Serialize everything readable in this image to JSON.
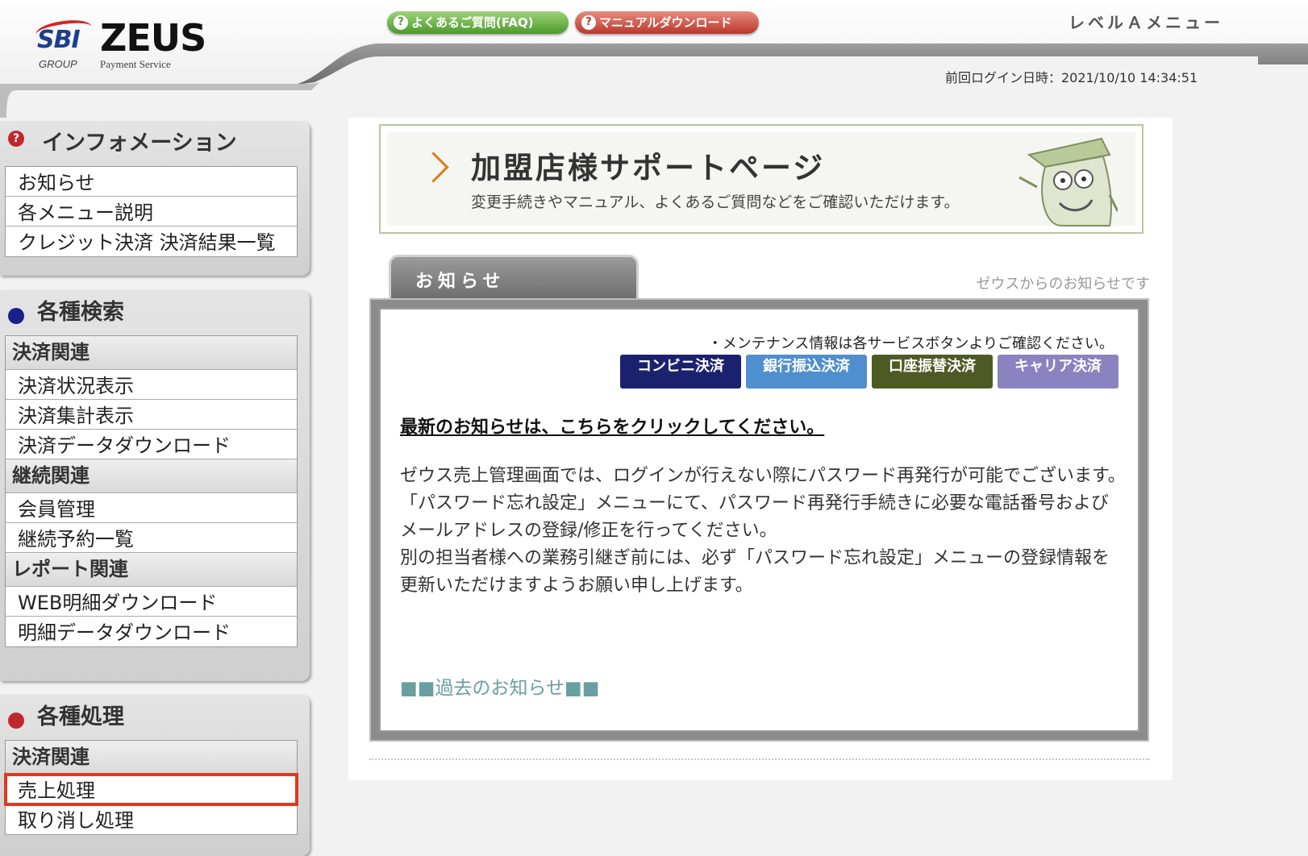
{
  "header": {
    "logo_sbi": "SBI",
    "logo_group": "GROUP",
    "logo_zeus": "ZEUS",
    "logo_payment": "Payment Service",
    "faq_button": "よくあるご質問(FAQ)",
    "manual_button": "マニュアルダウンロード",
    "level_menu": "レベルＡメニュー",
    "last_login": "前回ログイン日時：2021/10/10 14:34:51"
  },
  "sidebar": {
    "info": {
      "title": "インフォメーション",
      "items": [
        "お知らせ",
        "各メニュー説明",
        "クレジット決済 決済結果一覧"
      ]
    },
    "search": {
      "title": "各種検索",
      "groups": [
        {
          "heading": "決済関連",
          "items": [
            "決済状況表示",
            "決済集計表示",
            "決済データダウンロード"
          ]
        },
        {
          "heading": "継続関連",
          "items": [
            "会員管理",
            "継続予約一覧"
          ]
        },
        {
          "heading": "レポート関連",
          "items": [
            "WEB明細ダウンロード",
            "明細データダウンロード"
          ]
        }
      ]
    },
    "process": {
      "title": "各種処理",
      "groups": [
        {
          "heading": "決済関連",
          "items": [
            "売上処理",
            "取り消し処理"
          ]
        }
      ]
    }
  },
  "main": {
    "banner_title": "加盟店様サポートページ",
    "banner_sub": "変更手続きやマニュアル、よくあるご質問などをご確認いただけます。",
    "news_tab": "お知らせ",
    "news_tab_sub": "ゼウスからのお知らせです",
    "maintenance_note": "・メンテナンス情報は各サービスボタンよりご確認ください。",
    "service_buttons": [
      "コンビニ決済",
      "銀行振込決済",
      "口座振替決済",
      "キャリア決済"
    ],
    "latest_link": "最新のお知らせは、こちらをクリックしてください。",
    "body": [
      "ゼウス売上管理画面では、ログインが行えない際にパスワード再発行が可能でございます。",
      "「パスワード忘れ設定」メニューにて、パスワード再発行手続きに必要な電話番号およびメールアドレスの登録/修正を行ってください。",
      "別の担当者様への業務引継ぎ前には、必ず「パスワード忘れ設定」メニューの登録情報を更新いただけますようお願い申し上げます。"
    ],
    "past_link": "■■過去のお知らせ■■"
  },
  "colors": {
    "faq_green": "#4c9a2a",
    "manual_red": "#b8382a",
    "highlight_border": "#e0391e",
    "convenience_btn": "#1a2270",
    "bank_btn": "#4f8ecf",
    "account_btn": "#4e5a24",
    "carrier_btn": "#8a83c0"
  }
}
